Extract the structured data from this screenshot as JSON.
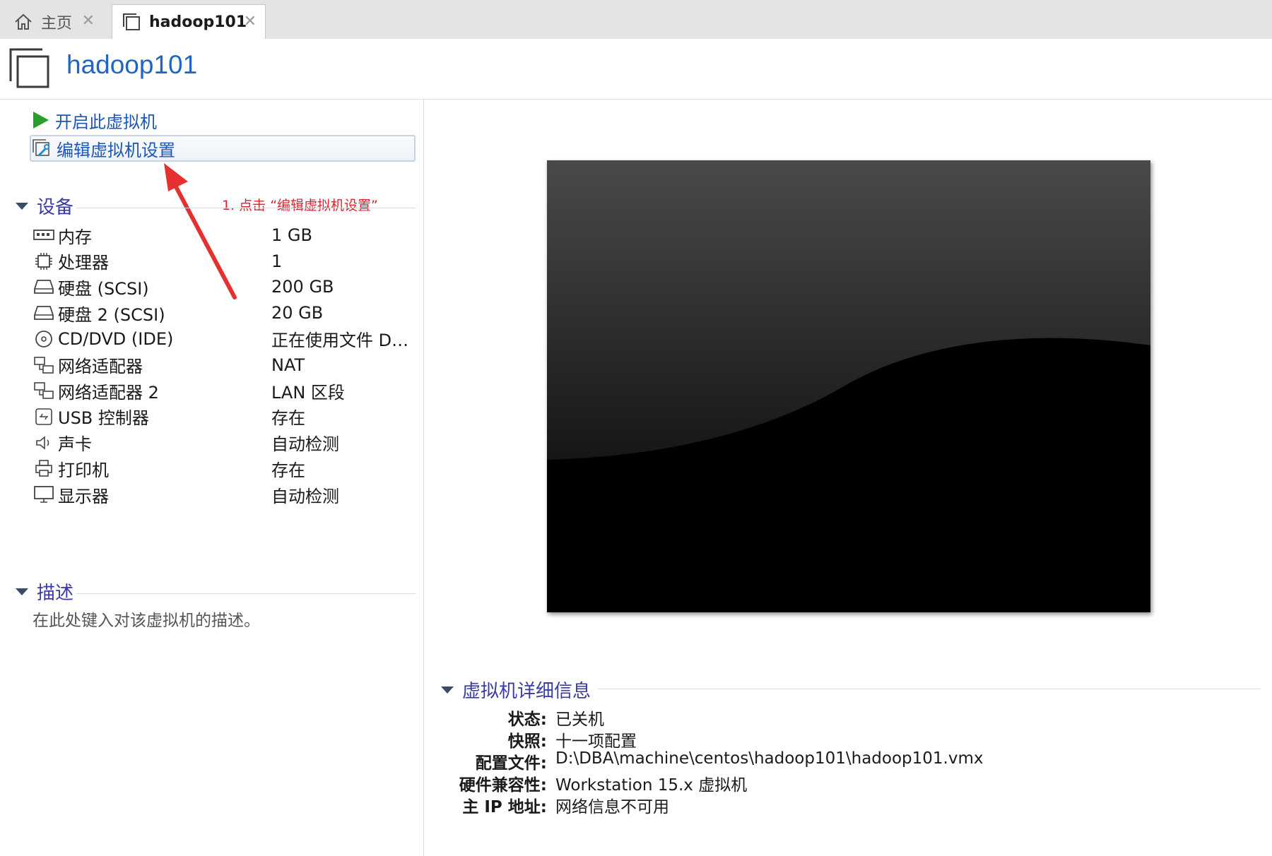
{
  "tabs": {
    "home_label": "主页",
    "vm_label": "hadoop101",
    "close_glyph": "✕"
  },
  "header": {
    "title": "hadoop101"
  },
  "actions": {
    "start_label": "开启此虚拟机",
    "edit_label": "编辑虚拟机设置"
  },
  "annotation": {
    "text": "1. 点击 “编辑虚拟机设置”",
    "color": "#e0202e"
  },
  "devices": {
    "heading": "设备",
    "rows": [
      {
        "icon": "memory-icon",
        "name": "内存",
        "value": "1 GB"
      },
      {
        "icon": "processor-icon",
        "name": "处理器",
        "value": "1"
      },
      {
        "icon": "harddisk-icon",
        "name": "硬盘 (SCSI)",
        "value": "200 GB"
      },
      {
        "icon": "harddisk-icon",
        "name": "硬盘 2 (SCSI)",
        "value": "20 GB"
      },
      {
        "icon": "cd-dvd-icon",
        "name": "CD/DVD (IDE)",
        "value": "正在使用文件 D:..."
      },
      {
        "icon": "network-adapter-icon",
        "name": "网络适配器",
        "value": "NAT"
      },
      {
        "icon": "network-adapter-icon",
        "name": "网络适配器 2",
        "value": "LAN 区段"
      },
      {
        "icon": "usb-icon",
        "name": "USB 控制器",
        "value": "存在"
      },
      {
        "icon": "sound-icon",
        "name": "声卡",
        "value": "自动检测"
      },
      {
        "icon": "printer-icon",
        "name": "打印机",
        "value": "存在"
      },
      {
        "icon": "display-icon",
        "name": "显示器",
        "value": "自动检测"
      }
    ]
  },
  "description": {
    "heading": "描述",
    "placeholder": "在此处键入对该虚拟机的描述。"
  },
  "details": {
    "heading": "虚拟机详细信息",
    "status_label": "状态:",
    "status_value": "已关机",
    "snapshot_label": "快照:",
    "snapshot_value": "十一项配置",
    "config_label": "配置文件:",
    "config_value": "D:\\DBA\\machine\\centos\\hadoop101\\hadoop101.vmx",
    "compat_label": "硬件兼容性:",
    "compat_value": "Workstation 15.x 虚拟机",
    "ip_label": "主 IP 地址:",
    "ip_value": "网络信息不可用"
  },
  "colors": {
    "link_blue": "#1f56b4",
    "title_blue": "#1f65c4",
    "section_purple": "#3a3aa8",
    "play_green": "#2aa02a",
    "annotation_red": "#e0202e"
  }
}
